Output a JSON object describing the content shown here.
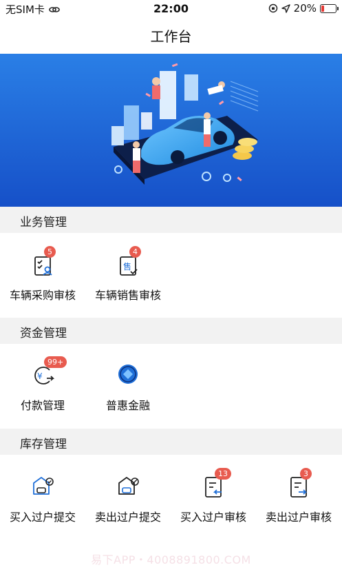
{
  "status_bar": {
    "carrier": "无SIM卡",
    "time": "22:00",
    "battery_percent": "20%",
    "battery_level": 0.2
  },
  "nav": {
    "title": "工作台"
  },
  "sections": [
    {
      "title": "业务管理",
      "items": [
        {
          "label": "车辆采购审核",
          "badge": "5",
          "icon": "purchase-review-icon"
        },
        {
          "label": "车辆销售审核",
          "badge": "4",
          "icon": "sale-review-icon"
        }
      ]
    },
    {
      "title": "资金管理",
      "items": [
        {
          "label": "付款管理",
          "badge": "99+",
          "icon": "payment-icon"
        },
        {
          "label": "普惠金融",
          "badge": "",
          "icon": "finance-icon"
        }
      ]
    },
    {
      "title": "库存管理",
      "items": [
        {
          "label": "买入过户提交",
          "badge": "",
          "icon": "buy-transfer-submit-icon"
        },
        {
          "label": "卖出过户提交",
          "badge": "",
          "icon": "sell-transfer-submit-icon"
        },
        {
          "label": "买入过户审核",
          "badge": "13",
          "icon": "buy-transfer-review-icon"
        },
        {
          "label": "卖出过户审核",
          "badge": "3",
          "icon": "sell-transfer-review-icon"
        }
      ]
    }
  ],
  "watermark": "易下APP・4008891800.COM",
  "colors": {
    "accent_blue": "#1f6fd8",
    "badge_red": "#e85b4f",
    "section_bg": "#f2f2f2"
  }
}
